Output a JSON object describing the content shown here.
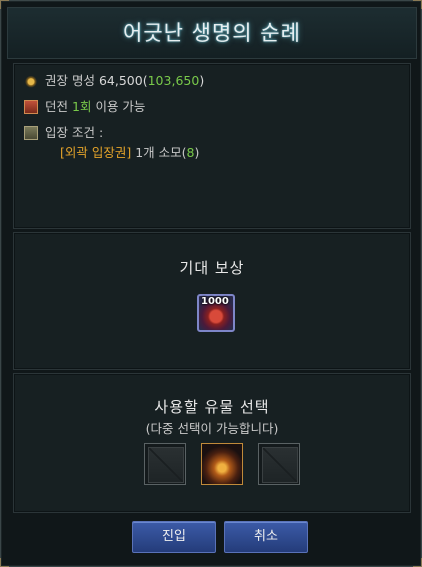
{
  "window": {
    "title": "어긋난 생명의 순례"
  },
  "info": {
    "scepter_label": "권장 명성",
    "scepter_value": "64,500",
    "scepter_open": "(",
    "scepter_extra": "103,650",
    "scepter_close": ")",
    "dungeon_label": "던전",
    "dungeon_count": "1회",
    "dungeon_suffix": "이용 가능",
    "entry_label": "입장 조건 :",
    "entry_item": "[외곽 입장권]",
    "entry_cost": "1개 소모",
    "entry_open": "(",
    "entry_have": "8",
    "entry_close": ")"
  },
  "reward": {
    "title": "기대 보상",
    "item_badge": "1000",
    "item_icon": "reputation-token-icon"
  },
  "relic": {
    "title": "사용할 유물 선택",
    "subtitle": "(다중 선택이 가능합니다)",
    "slots": [
      "empty-slot",
      "relic-crown-icon",
      "empty-slot"
    ]
  },
  "buttons": {
    "enter": "진입",
    "cancel": "취소"
  },
  "colors": {
    "green": "#79c94a",
    "gold": "#e4a32a",
    "button": "#2f4a90"
  }
}
